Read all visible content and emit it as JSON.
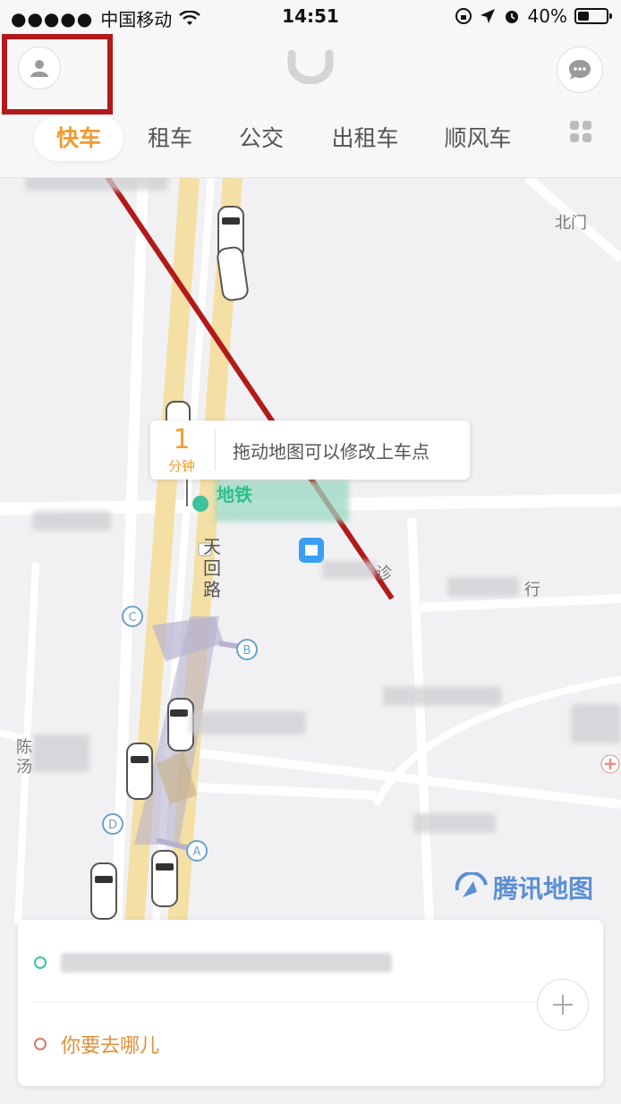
{
  "status": {
    "carrier": "中国移动",
    "time": "14:51",
    "battery": "40%",
    "battery_level": 0.4
  },
  "tabs": [
    {
      "label": "快车",
      "active": true
    },
    {
      "label": "租车",
      "active": false
    },
    {
      "label": "公交",
      "active": false
    },
    {
      "label": "出租车",
      "active": false
    },
    {
      "label": "顺风车",
      "active": false
    }
  ],
  "map": {
    "eta": {
      "value": "1",
      "unit": "分钟",
      "message": "拖动地图可以修改上车点"
    },
    "road_name": "天回路",
    "poi_label": "地铁",
    "north_gate": "北门",
    "clinic": "诊",
    "bank": "行",
    "left_label_1": "陈",
    "left_label_2": "汤",
    "markers": [
      "A",
      "B",
      "C",
      "D"
    ],
    "watermark": "腾讯地图"
  },
  "panel": {
    "destination_placeholder": "你要去哪儿"
  },
  "colors": {
    "accent": "#f29b30",
    "annotation": "#b21a1a",
    "start_dot": "#3cc39a",
    "dest_text": "#e1903c"
  }
}
